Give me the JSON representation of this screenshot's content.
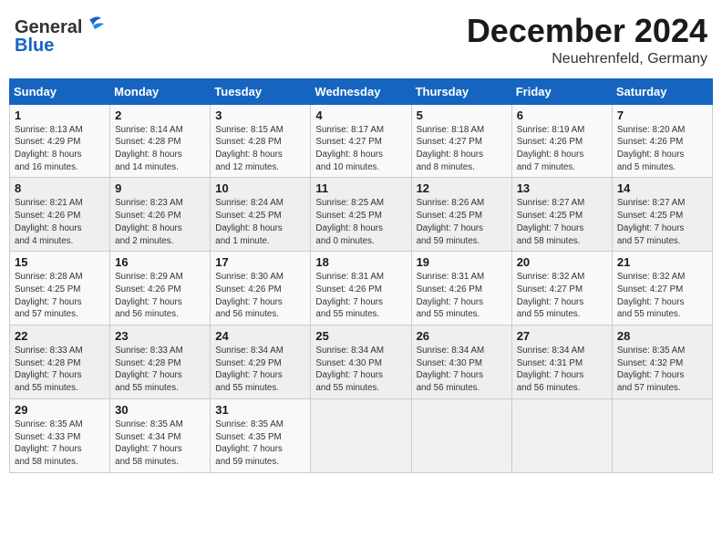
{
  "header": {
    "logo_general": "General",
    "logo_blue": "Blue",
    "month_title": "December 2024",
    "location": "Neuehrenfeld, Germany"
  },
  "weekdays": [
    "Sunday",
    "Monday",
    "Tuesday",
    "Wednesday",
    "Thursday",
    "Friday",
    "Saturday"
  ],
  "weeks": [
    [
      {
        "day": "1",
        "info": "Sunrise: 8:13 AM\nSunset: 4:29 PM\nDaylight: 8 hours\nand 16 minutes."
      },
      {
        "day": "2",
        "info": "Sunrise: 8:14 AM\nSunset: 4:28 PM\nDaylight: 8 hours\nand 14 minutes."
      },
      {
        "day": "3",
        "info": "Sunrise: 8:15 AM\nSunset: 4:28 PM\nDaylight: 8 hours\nand 12 minutes."
      },
      {
        "day": "4",
        "info": "Sunrise: 8:17 AM\nSunset: 4:27 PM\nDaylight: 8 hours\nand 10 minutes."
      },
      {
        "day": "5",
        "info": "Sunrise: 8:18 AM\nSunset: 4:27 PM\nDaylight: 8 hours\nand 8 minutes."
      },
      {
        "day": "6",
        "info": "Sunrise: 8:19 AM\nSunset: 4:26 PM\nDaylight: 8 hours\nand 7 minutes."
      },
      {
        "day": "7",
        "info": "Sunrise: 8:20 AM\nSunset: 4:26 PM\nDaylight: 8 hours\nand 5 minutes."
      }
    ],
    [
      {
        "day": "8",
        "info": "Sunrise: 8:21 AM\nSunset: 4:26 PM\nDaylight: 8 hours\nand 4 minutes."
      },
      {
        "day": "9",
        "info": "Sunrise: 8:23 AM\nSunset: 4:26 PM\nDaylight: 8 hours\nand 2 minutes."
      },
      {
        "day": "10",
        "info": "Sunrise: 8:24 AM\nSunset: 4:25 PM\nDaylight: 8 hours\nand 1 minute."
      },
      {
        "day": "11",
        "info": "Sunrise: 8:25 AM\nSunset: 4:25 PM\nDaylight: 8 hours\nand 0 minutes."
      },
      {
        "day": "12",
        "info": "Sunrise: 8:26 AM\nSunset: 4:25 PM\nDaylight: 7 hours\nand 59 minutes."
      },
      {
        "day": "13",
        "info": "Sunrise: 8:27 AM\nSunset: 4:25 PM\nDaylight: 7 hours\nand 58 minutes."
      },
      {
        "day": "14",
        "info": "Sunrise: 8:27 AM\nSunset: 4:25 PM\nDaylight: 7 hours\nand 57 minutes."
      }
    ],
    [
      {
        "day": "15",
        "info": "Sunrise: 8:28 AM\nSunset: 4:25 PM\nDaylight: 7 hours\nand 57 minutes."
      },
      {
        "day": "16",
        "info": "Sunrise: 8:29 AM\nSunset: 4:26 PM\nDaylight: 7 hours\nand 56 minutes."
      },
      {
        "day": "17",
        "info": "Sunrise: 8:30 AM\nSunset: 4:26 PM\nDaylight: 7 hours\nand 56 minutes."
      },
      {
        "day": "18",
        "info": "Sunrise: 8:31 AM\nSunset: 4:26 PM\nDaylight: 7 hours\nand 55 minutes."
      },
      {
        "day": "19",
        "info": "Sunrise: 8:31 AM\nSunset: 4:26 PM\nDaylight: 7 hours\nand 55 minutes."
      },
      {
        "day": "20",
        "info": "Sunrise: 8:32 AM\nSunset: 4:27 PM\nDaylight: 7 hours\nand 55 minutes."
      },
      {
        "day": "21",
        "info": "Sunrise: 8:32 AM\nSunset: 4:27 PM\nDaylight: 7 hours\nand 55 minutes."
      }
    ],
    [
      {
        "day": "22",
        "info": "Sunrise: 8:33 AM\nSunset: 4:28 PM\nDaylight: 7 hours\nand 55 minutes."
      },
      {
        "day": "23",
        "info": "Sunrise: 8:33 AM\nSunset: 4:28 PM\nDaylight: 7 hours\nand 55 minutes."
      },
      {
        "day": "24",
        "info": "Sunrise: 8:34 AM\nSunset: 4:29 PM\nDaylight: 7 hours\nand 55 minutes."
      },
      {
        "day": "25",
        "info": "Sunrise: 8:34 AM\nSunset: 4:30 PM\nDaylight: 7 hours\nand 55 minutes."
      },
      {
        "day": "26",
        "info": "Sunrise: 8:34 AM\nSunset: 4:30 PM\nDaylight: 7 hours\nand 56 minutes."
      },
      {
        "day": "27",
        "info": "Sunrise: 8:34 AM\nSunset: 4:31 PM\nDaylight: 7 hours\nand 56 minutes."
      },
      {
        "day": "28",
        "info": "Sunrise: 8:35 AM\nSunset: 4:32 PM\nDaylight: 7 hours\nand 57 minutes."
      }
    ],
    [
      {
        "day": "29",
        "info": "Sunrise: 8:35 AM\nSunset: 4:33 PM\nDaylight: 7 hours\nand 58 minutes."
      },
      {
        "day": "30",
        "info": "Sunrise: 8:35 AM\nSunset: 4:34 PM\nDaylight: 7 hours\nand 58 minutes."
      },
      {
        "day": "31",
        "info": "Sunrise: 8:35 AM\nSunset: 4:35 PM\nDaylight: 7 hours\nand 59 minutes."
      },
      null,
      null,
      null,
      null
    ]
  ]
}
